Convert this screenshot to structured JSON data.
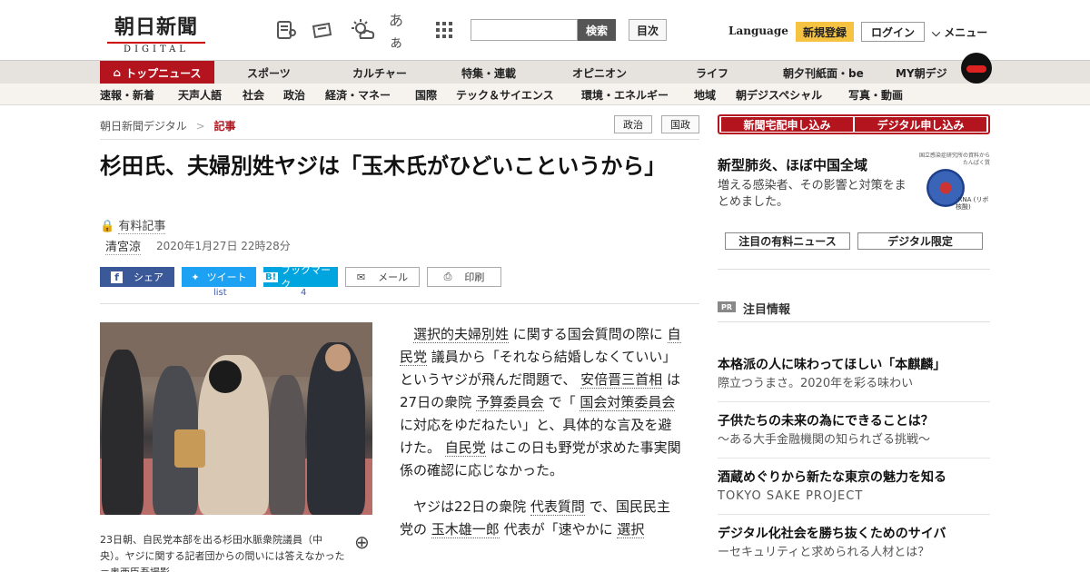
{
  "header": {
    "logo_ja": "朝日新聞",
    "logo_en": "DIGITAL",
    "search_button": "検索",
    "toc_button": "目次",
    "language": "Language",
    "signup": "新規登録",
    "login": "ログイン",
    "menu": "メニュー",
    "tool_icons": [
      "news-icon",
      "ticket-icon",
      "weather-icon",
      "font-size-icon",
      "grid-icon"
    ],
    "font_glyph": "あぁ"
  },
  "nav_primary": [
    "トップニュース",
    "スポーツ",
    "カルチャー",
    "特集・連載",
    "オピニオン",
    "ライフ",
    "朝夕刊紙面・be",
    "MY朝デジ"
  ],
  "nav_secondary": [
    "速報・新着",
    "天声人語",
    "社会",
    "政治",
    "経済・マネー",
    "国際",
    "テック＆サイエンス",
    "環境・エネルギー",
    "地域",
    "朝デジスペシャル",
    "写真・動画"
  ],
  "breadcrumb": {
    "home": "朝日新聞デジタル",
    "sep": ">",
    "current": "記事"
  },
  "tags": [
    "政治",
    "国政"
  ],
  "article": {
    "title": "杉田氏、夫婦別姓ヤジは「玉木氏がひどいこというから」",
    "paid_label": "有料記事",
    "author": "清宮涼",
    "date": "2020年1月27日 22時28分",
    "share": {
      "facebook": "シェア",
      "twitter": "ツイート",
      "twitter_count": "list",
      "hatena": "ブックマーク",
      "hatena_count": "4",
      "mail": "メール",
      "print": "印刷"
    },
    "caption": "23日朝、自民党本部を出る杉田水脈衆院議員（中央）。ヤジに関する記者団からの問いには答えなかった＝奥西臣吾撮影",
    "body_p1": [
      {
        "t": "選択的夫婦別姓",
        "u": true
      },
      {
        "t": " に関する国会質問の際に "
      },
      {
        "t": "自民党",
        "u": true
      },
      {
        "t": " 議員から「それなら結婚しなくていい」というヤジが飛んだ問題で、 "
      },
      {
        "t": "安倍晋三首相",
        "u": true
      },
      {
        "t": " は27日の衆院 "
      },
      {
        "t": "予算委員会",
        "u": true
      },
      {
        "t": " で「 "
      },
      {
        "t": "国会対策委員会",
        "u": true
      },
      {
        "t": " に対応をゆだねたい」と、具体的な言及を避けた。 "
      },
      {
        "t": "自民党",
        "u": true
      },
      {
        "t": " はこの日も野党が求めた事実関係の確認に応じなかった。"
      }
    ],
    "body_p2": [
      {
        "t": "ヤジは22日の衆院 "
      },
      {
        "t": "代表質問",
        "u": true
      },
      {
        "t": " で、国民民主党の "
      },
      {
        "t": "玉木雄一郎",
        "u": true
      },
      {
        "t": " 代表が「速やかに "
      },
      {
        "t": "選択",
        "u": true
      }
    ]
  },
  "sidebar": {
    "subscribe_paper": "新聞宅配申し込み",
    "subscribe_digital": "デジタル申し込み",
    "feature_title": "新型肺炎、ほぼ中国全域",
    "feature_text": "増える感染者、その影響と対策をまとめました。",
    "virus_label": "-RNA (リボ核酸)",
    "virus_header": "国立感染症研究所の資料から たんぱく質",
    "btn_paid_news": "注目の有料ニュース",
    "btn_digital_only": "デジタル限定",
    "pr_badge": "PR",
    "pr_title": "注目情報",
    "ads": [
      {
        "title": "本格派の人に味わってほしい「本麒麟」",
        "sub": "際立つうまさ。2020年を彩る味わい"
      },
      {
        "title": "子供たちの未来の為にできることは？",
        "sub": "～ある大手金融機関の知られざる挑戦～"
      },
      {
        "title": "酒蔵めぐりから新たな東京の魅力を知る",
        "sub": "TOKYO SAKE PROJECT"
      },
      {
        "title": "デジタル化社会を勝ち抜くためのサイバ",
        "sub": "ーセキュリティと求められる人材とは？"
      }
    ]
  },
  "colors": {
    "brand_red": "#b3141e",
    "signup_yellow": "#f5c242",
    "facebook": "#3b5998",
    "twitter": "#1da1f2",
    "hatena": "#00a4de"
  }
}
